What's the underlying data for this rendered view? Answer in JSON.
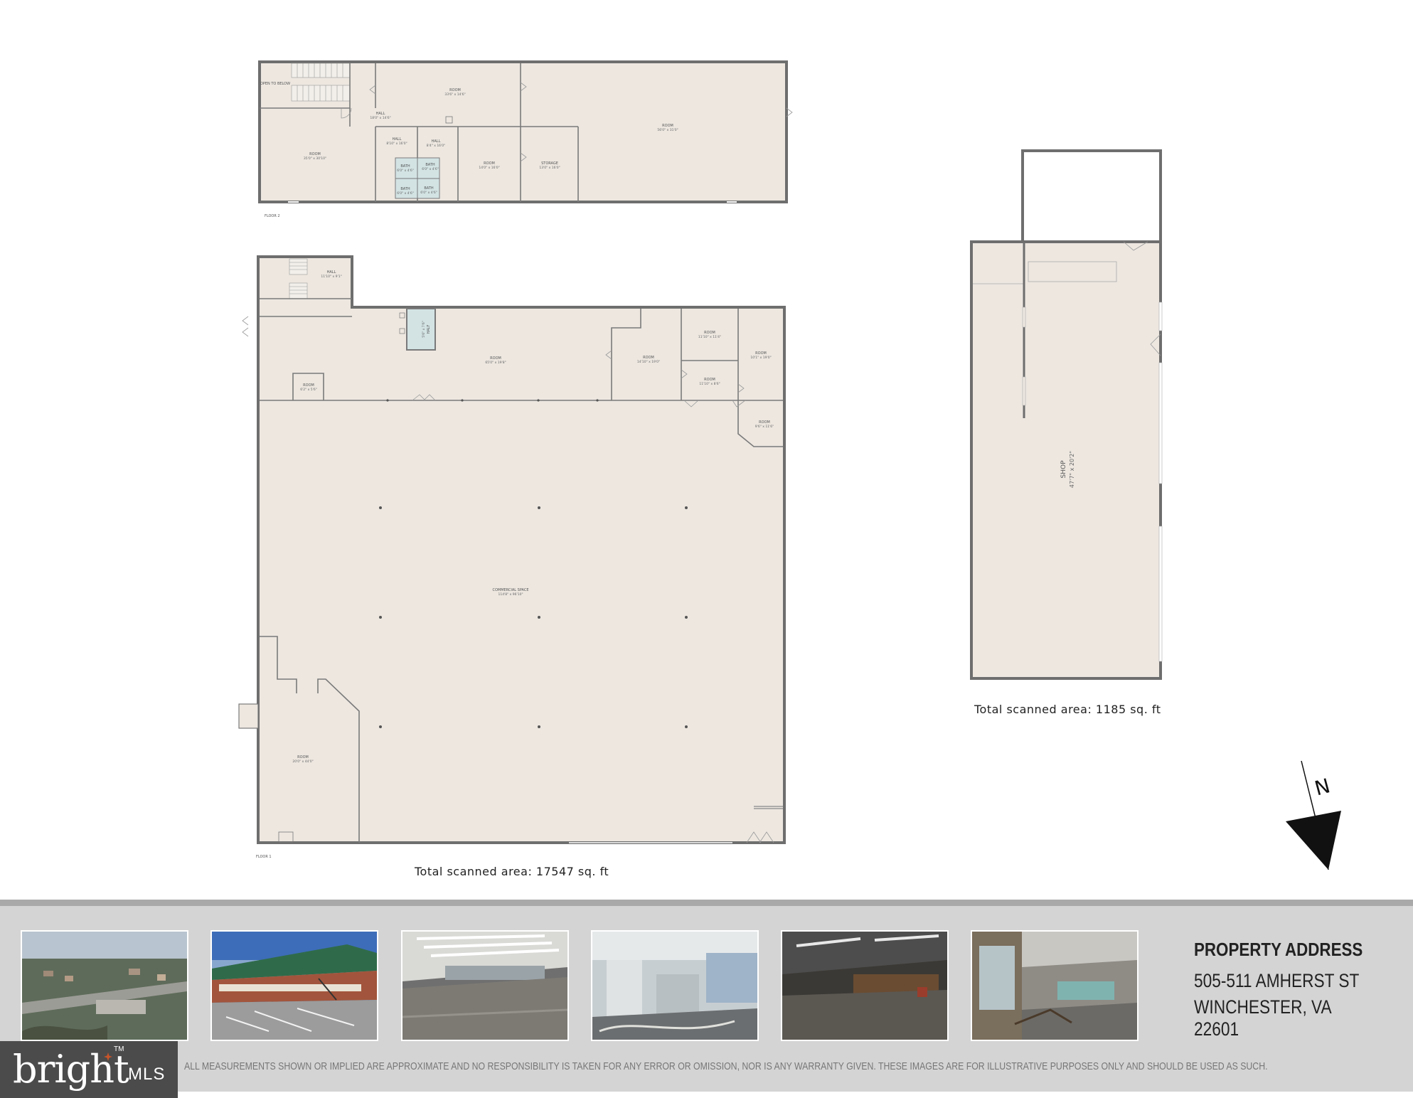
{
  "floor2": {
    "level_label": "FLOOR 2",
    "rooms": [
      {
        "name": "OPEN TO BELOW",
        "dims": ""
      },
      {
        "name": "ROOM",
        "dims": "33'6\" x 14'6\""
      },
      {
        "name": "HALL",
        "dims": "18'0\" x 14'6\""
      },
      {
        "name": "ROOM",
        "dims": "56'0\" x 31'0\""
      },
      {
        "name": "ROOM",
        "dims": "35'0\" x 30'10\""
      },
      {
        "name": "HALL",
        "dims": "8'10\" x 16'0\""
      },
      {
        "name": "HALL",
        "dims": "8'4\" x 16'0\""
      },
      {
        "name": "BATH",
        "dims": "6'0\" x 4'6\""
      },
      {
        "name": "BATH",
        "dims": "6'0\" x 4'6\""
      },
      {
        "name": "BATH",
        "dims": "6'0\" x 4'6\""
      },
      {
        "name": "BATH",
        "dims": "6'0\" x 4'6\""
      },
      {
        "name": "ROOM",
        "dims": "14'0\" x 16'0\""
      },
      {
        "name": "STORAGE",
        "dims": "13'0\" x 16'0\""
      }
    ]
  },
  "floor1": {
    "level_label": "FLOOR 1",
    "rooms": [
      {
        "name": "HALL",
        "dims": "11'10\" x 9'1\""
      },
      {
        "name": "HALF",
        "dims": "5'6\" x 7'6\""
      },
      {
        "name": "ROOM",
        "dims": "65'0\" x 19'8\""
      },
      {
        "name": "ROOM",
        "dims": "6'2\" x 5'6\""
      },
      {
        "name": "ROOM",
        "dims": "14'10\" x 19'0\""
      },
      {
        "name": "ROOM",
        "dims": "11'10\" x 11'4\""
      },
      {
        "name": "ROOM",
        "dims": "11'10\" x 8'6\""
      },
      {
        "name": "ROOM",
        "dims": "10'1\" x 19'0\""
      },
      {
        "name": "ROOM",
        "dims": "9'6\" x 11'6\""
      },
      {
        "name": "COMMERCIAL SPACE",
        "dims": "114'8\" x 96'10\""
      },
      {
        "name": "ROOM",
        "dims": "20'0\" x 44'0\""
      }
    ],
    "total_area": "Total scanned area: 17547 sq. ft"
  },
  "shop": {
    "name": "SHOP",
    "dims": "47'7\" x 20'2\"",
    "total_area": "Total scanned area: 1185 sq. ft"
  },
  "compass": {
    "letter": "N",
    "icon": "north-arrow-icon"
  },
  "photos": [
    {
      "icon": "aerial-photo-icon"
    },
    {
      "icon": "building-exterior-photo-icon"
    },
    {
      "icon": "interior-photo-icon"
    },
    {
      "icon": "interior-photo-icon"
    },
    {
      "icon": "interior-photo-icon"
    },
    {
      "icon": "interior-photo-icon"
    }
  ],
  "property": {
    "heading": "PROPERTY ADDRESS",
    "line1": "505-511 AMHERST ST",
    "line2": "WINCHESTER, VA  22601"
  },
  "disclaimer": "ALL MEASUREMENTS SHOWN OR IMPLIED ARE APPROXIMATE AND NO RESPONSIBILITY IS TAKEN FOR ANY ERROR OR OMISSION, NOR IS ANY WARRANTY GIVEN.  THESE IMAGES ARE FOR ILLUSTRATIVE PURPOSES ONLY AND SHOULD BE USED AS SUCH.",
  "logo": {
    "word": "bright",
    "suffix": "MLS",
    "tm": "TM"
  },
  "colors": {
    "floor_fill": "#ede7e0",
    "wall": "#6e6e6e",
    "bath_fill": "#d3e3e4",
    "footer_bg": "#d4d4d4",
    "logo_bg": "#4b4b4b",
    "logo_spark": "#c8542a"
  }
}
